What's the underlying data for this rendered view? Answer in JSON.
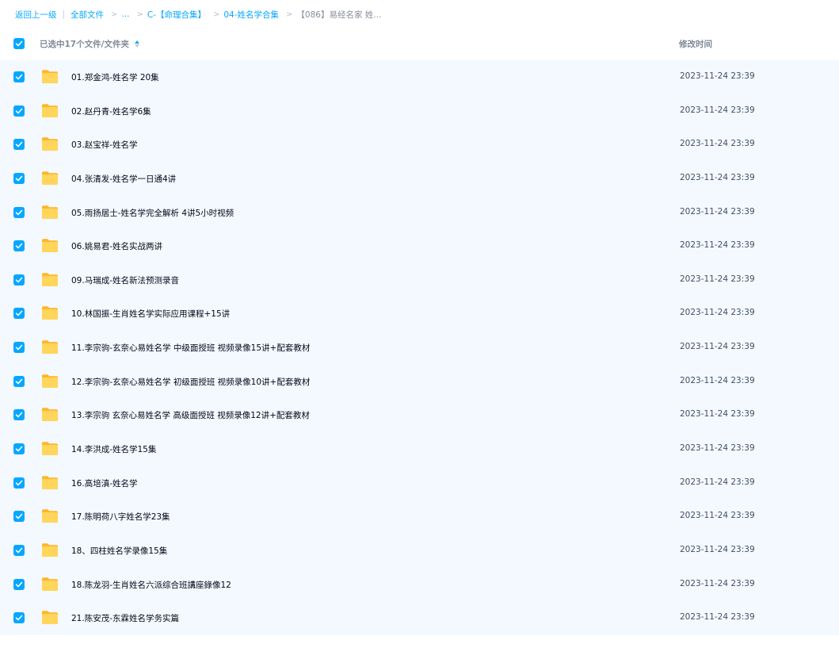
{
  "colors": {
    "accent": "#06a7ff",
    "row_selected_bg": "#f3f9fe",
    "folder": "#ffc53d"
  },
  "breadcrumb": {
    "back": "返回上一级",
    "sep": "|",
    "all_files": "全部文件",
    "ellipsis": "...",
    "level1": "C-【命理合集】",
    "level2": "04-姓名学合集",
    "current": "【086】易经名家 姓..."
  },
  "header": {
    "select_all_checked": true,
    "selection_label": "已选中17个文件/文件夹",
    "sort_icon": "sort-icon",
    "modified_label": "修改时间"
  },
  "files": [
    {
      "name": "01.郑金鸿-姓名学 20集",
      "modified": "2023-11-24 23:39",
      "checked": true,
      "icon": "folder-icon"
    },
    {
      "name": "02.赵丹青-姓名学6集",
      "modified": "2023-11-24 23:39",
      "checked": true,
      "icon": "folder-icon"
    },
    {
      "name": "03.赵宝祥-姓名学",
      "modified": "2023-11-24 23:39",
      "checked": true,
      "icon": "folder-icon"
    },
    {
      "name": "04.张清发-姓名学一日通4讲",
      "modified": "2023-11-24 23:39",
      "checked": true,
      "icon": "folder-icon"
    },
    {
      "name": "05.雨扬居士-姓名学完全解析 4讲5小时视频",
      "modified": "2023-11-24 23:39",
      "checked": true,
      "icon": "folder-icon"
    },
    {
      "name": "06.姚易君-姓名实战两讲",
      "modified": "2023-11-24 23:39",
      "checked": true,
      "icon": "folder-icon"
    },
    {
      "name": "09.马瑞成-姓名新法预测录音",
      "modified": "2023-11-24 23:39",
      "checked": true,
      "icon": "folder-icon"
    },
    {
      "name": "10.林国振-生肖姓名学实际应用课程+15讲",
      "modified": "2023-11-24 23:39",
      "checked": true,
      "icon": "folder-icon"
    },
    {
      "name": "11.李宗驹-玄奈心易姓名学 中级面授班 视频录像15讲+配套教材",
      "modified": "2023-11-24 23:39",
      "checked": true,
      "icon": "folder-icon"
    },
    {
      "name": "12.李宗驹-玄奈心易姓名学 初级面授班 视频录像10讲+配套教材",
      "modified": "2023-11-24 23:39",
      "checked": true,
      "icon": "folder-icon"
    },
    {
      "name": "13.李宗驹 玄奈心易姓名学 高级面授班 视频录像12讲+配套教材",
      "modified": "2023-11-24 23:39",
      "checked": true,
      "icon": "folder-icon"
    },
    {
      "name": "14.李洪成-姓名学15集",
      "modified": "2023-11-24 23:39",
      "checked": true,
      "icon": "folder-icon"
    },
    {
      "name": "16.高培滇-姓名学",
      "modified": "2023-11-24 23:39",
      "checked": true,
      "icon": "folder-icon"
    },
    {
      "name": "17.陈明荷八字姓名学23集",
      "modified": "2023-11-24 23:39",
      "checked": true,
      "icon": "folder-icon"
    },
    {
      "name": "18、四柱姓名学录像15集",
      "modified": "2023-11-24 23:39",
      "checked": true,
      "icon": "folder-icon"
    },
    {
      "name": "18.陈龙羽-生肖姓名六派综合班講座錄像12",
      "modified": "2023-11-24 23:39",
      "checked": true,
      "icon": "folder-icon"
    },
    {
      "name": "21.陈安茂-东霖姓名学务实篇",
      "modified": "2023-11-24 23:39",
      "checked": true,
      "icon": "folder-icon"
    }
  ]
}
